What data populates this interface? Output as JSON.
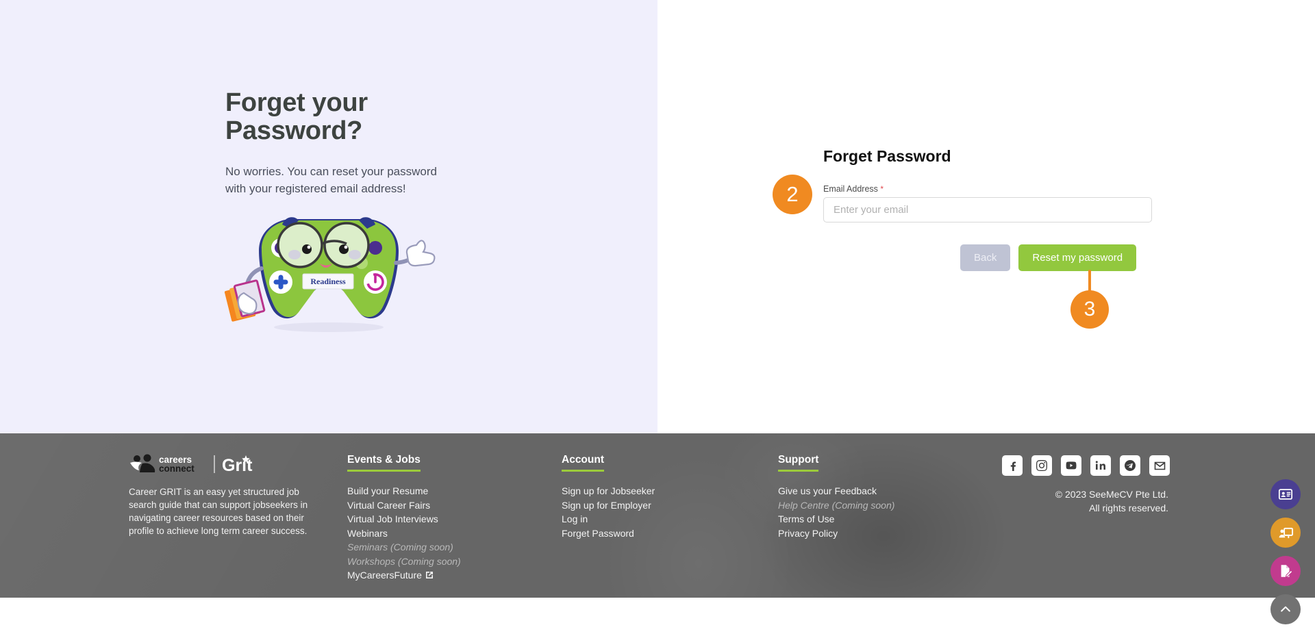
{
  "hero": {
    "title": "Forget your\nPassword?",
    "subtitle": "No worries. You can reset your password\nwith your registered email address!",
    "illustration_label": "Readiness"
  },
  "form": {
    "title": "Forget Password",
    "email_label": "Email Address",
    "required_mark": "*",
    "email_value": "",
    "email_placeholder": "Enter your email",
    "back_label": "Back",
    "reset_label": "Reset my password"
  },
  "steps": {
    "step2": "2",
    "step3": "3"
  },
  "footer": {
    "brand": {
      "logo_primary": "careers connect",
      "logo_secondary": "Grit",
      "description": "Career GRIT is an easy yet structured job search guide that can support jobseekers in navigating career resources based on their profile to achieve long term career success."
    },
    "columns": [
      {
        "heading": "Events & Jobs",
        "links": [
          {
            "label": "Build your Resume",
            "muted": false,
            "external": false
          },
          {
            "label": "Virtual Career Fairs",
            "muted": false,
            "external": false
          },
          {
            "label": "Virtual Job Interviews",
            "muted": false,
            "external": false
          },
          {
            "label": "Webinars",
            "muted": false,
            "external": false
          },
          {
            "label": "Seminars (Coming soon)",
            "muted": true,
            "external": false
          },
          {
            "label": "Workshops (Coming soon)",
            "muted": true,
            "external": false
          },
          {
            "label": "MyCareersFuture",
            "muted": false,
            "external": true
          }
        ]
      },
      {
        "heading": "Account",
        "links": [
          {
            "label": "Sign up for Jobseeker",
            "muted": false,
            "external": false
          },
          {
            "label": "Sign up for Employer",
            "muted": false,
            "external": false
          },
          {
            "label": "Log in",
            "muted": false,
            "external": false
          },
          {
            "label": "Forget Password",
            "muted": false,
            "external": false
          }
        ]
      },
      {
        "heading": "Support",
        "links": [
          {
            "label": "Give us your Feedback",
            "muted": false,
            "external": false
          },
          {
            "label": "Help Centre (Coming soon)",
            "muted": true,
            "external": false
          },
          {
            "label": "Terms of Use",
            "muted": false,
            "external": false
          },
          {
            "label": "Privacy Policy",
            "muted": false,
            "external": false
          }
        ]
      }
    ],
    "social": [
      "facebook-icon",
      "instagram-icon",
      "youtube-icon",
      "linkedin-icon",
      "telegram-icon",
      "email-icon"
    ],
    "copyright_line1": "© 2023 SeeMeCV Pte Ltd.",
    "copyright_line2": "All rights reserved."
  },
  "fabs": [
    {
      "name": "id-card-icon",
      "color": "#4a3f91"
    },
    {
      "name": "presentation-icon",
      "color": "#e09a2a"
    },
    {
      "name": "edit-document-icon",
      "color": "#c13b8e"
    },
    {
      "name": "scroll-to-top-icon",
      "color": "#727272"
    }
  ],
  "colors": {
    "left_panel_bg": "#f0effc",
    "accent_orange": "#f08a21",
    "accent_green": "#92c83e",
    "footer_bg": "#666666",
    "underline_green": "#9ccb3b"
  }
}
